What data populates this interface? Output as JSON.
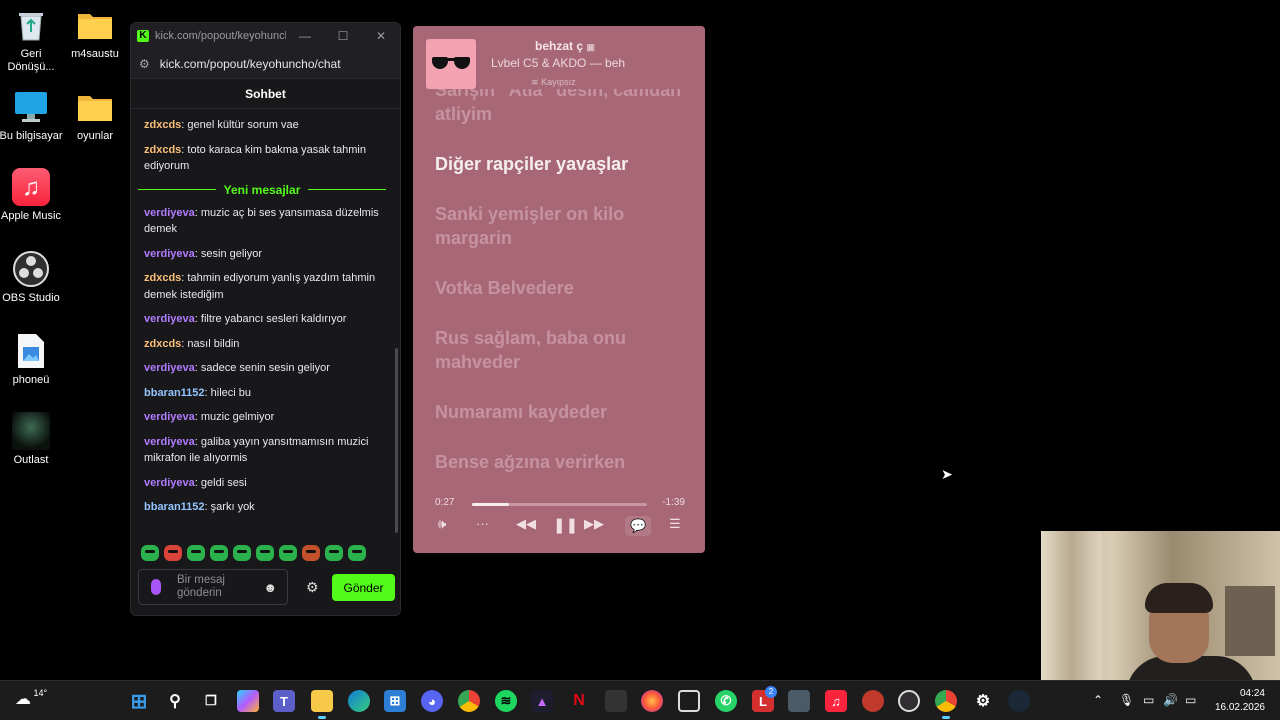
{
  "desktop": {
    "icons": [
      {
        "label": "Geri Dönüşü...",
        "icon": "recycle-bin-icon"
      },
      {
        "label": "m4saustu",
        "icon": "folder-icon"
      },
      {
        "label": "Bu bilgisayar",
        "icon": "computer-icon"
      },
      {
        "label": "oyunlar",
        "icon": "folder-icon"
      },
      {
        "label": "Apple Music",
        "icon": "apple-music-icon"
      },
      {
        "label": "OBS Studio",
        "icon": "obs-icon"
      },
      {
        "label": "phoneü",
        "icon": "image-file-icon"
      },
      {
        "label": "Outlast",
        "icon": "outlast-icon"
      }
    ]
  },
  "chat": {
    "window_title": "kick.com/popout/keyohuncho...",
    "url": "kick.com/popout/keyohuncho/chat",
    "header": "Sohbet",
    "new_messages_label": "Yeni mesajlar",
    "messages_before": [
      {
        "user": "zdxcds",
        "text": "genel kültür sorum vae",
        "color": "#fbbf7a"
      },
      {
        "user": "zdxcds",
        "text": "toto karaca kim bakma yasak tahmin ediyorum",
        "color": "#fbbf7a"
      }
    ],
    "messages_after": [
      {
        "user": "verdiyeva",
        "text": "muzic aç bi ses yansımasa düzelmis demek",
        "color": "#b17bff"
      },
      {
        "user": "verdiyeva",
        "text": "sesin geliyor",
        "color": "#b17bff"
      },
      {
        "user": "zdxcds",
        "text": "tahmin ediyorum yanlış yazdım tahmin demek istediğim",
        "color": "#fbbf7a"
      },
      {
        "user": "verdiyeva",
        "text": "filtre yabancı sesleri kaldırıyor",
        "color": "#b17bff"
      },
      {
        "user": "zdxcds",
        "text": "nasıl bildin",
        "color": "#fbbf7a"
      },
      {
        "user": "verdiyeva",
        "text": "sadece senin sesin geliyor",
        "color": "#b17bff"
      },
      {
        "user": "bbaran1152",
        "text": "hileci bu",
        "color": "#93c5fd"
      },
      {
        "user": "verdiyeva",
        "text": "muzic gelmiyor",
        "color": "#b17bff"
      },
      {
        "user": "verdiyeva",
        "text": "galiba yayın yansıtmamısın muzici mikrafon ile alıyormis",
        "color": "#b17bff"
      },
      {
        "user": "verdiyeva",
        "text": "geldi sesi",
        "color": "#b17bff"
      },
      {
        "user": "bbaran1152",
        "text": "şarkı yok",
        "color": "#93c5fd"
      }
    ],
    "input_placeholder": "Bir mesaj gönderin",
    "send_label": "Gönder",
    "accent": "#53fc18"
  },
  "music": {
    "title": "behzat ç",
    "artist": "Lvbel C5 & AKDO — beh",
    "quality": "Kayıpsız",
    "lyrics": [
      "Sarışın \"Atia\" desin, camdan atliyim",
      "Diğer rapçiler yavaşlar",
      "Sanki yemişler on kilo margarin",
      "Votka Belvedere",
      "Rus sağlam, baba onu mahveder",
      "Numaramı kaydeder",
      "Bense ağzına verirken"
    ],
    "active_lyric_index": 1,
    "time_current": "0:27",
    "time_remaining": "-1:39",
    "progress_fraction": 0.21,
    "bg_color": "#a86776"
  },
  "taskbar": {
    "weather": "14°",
    "time": "04:24",
    "date": "16.02.2026",
    "discord_badge": "2"
  }
}
